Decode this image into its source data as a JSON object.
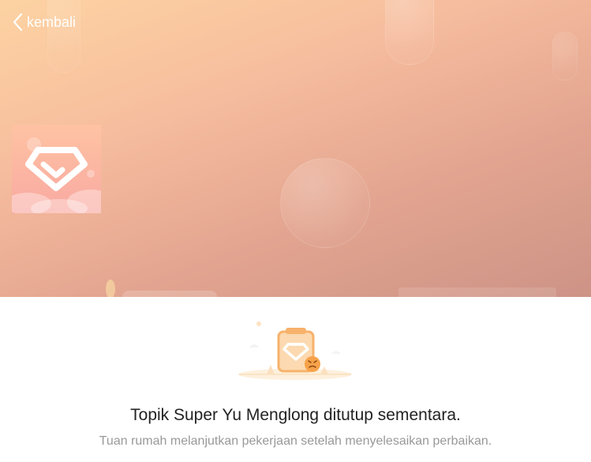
{
  "header": {
    "back_label": "kembali"
  },
  "colors": {
    "hero_top": "#fdd3a2",
    "hero_bottom": "#cd9386",
    "title_text": "#222222",
    "subtitle_text": "#999999",
    "accent_orange": "#f7b26b"
  },
  "icons": {
    "back": "chevron-left-icon",
    "avatar": "diamond-badge-icon",
    "illustration": "sad-clipboard-icon"
  },
  "notice": {
    "title": "Topik Super Yu Menglong ditutup sementara.",
    "subtitle": "Tuan rumah melanjutkan pekerjaan setelah menyelesaikan perbaikan."
  }
}
